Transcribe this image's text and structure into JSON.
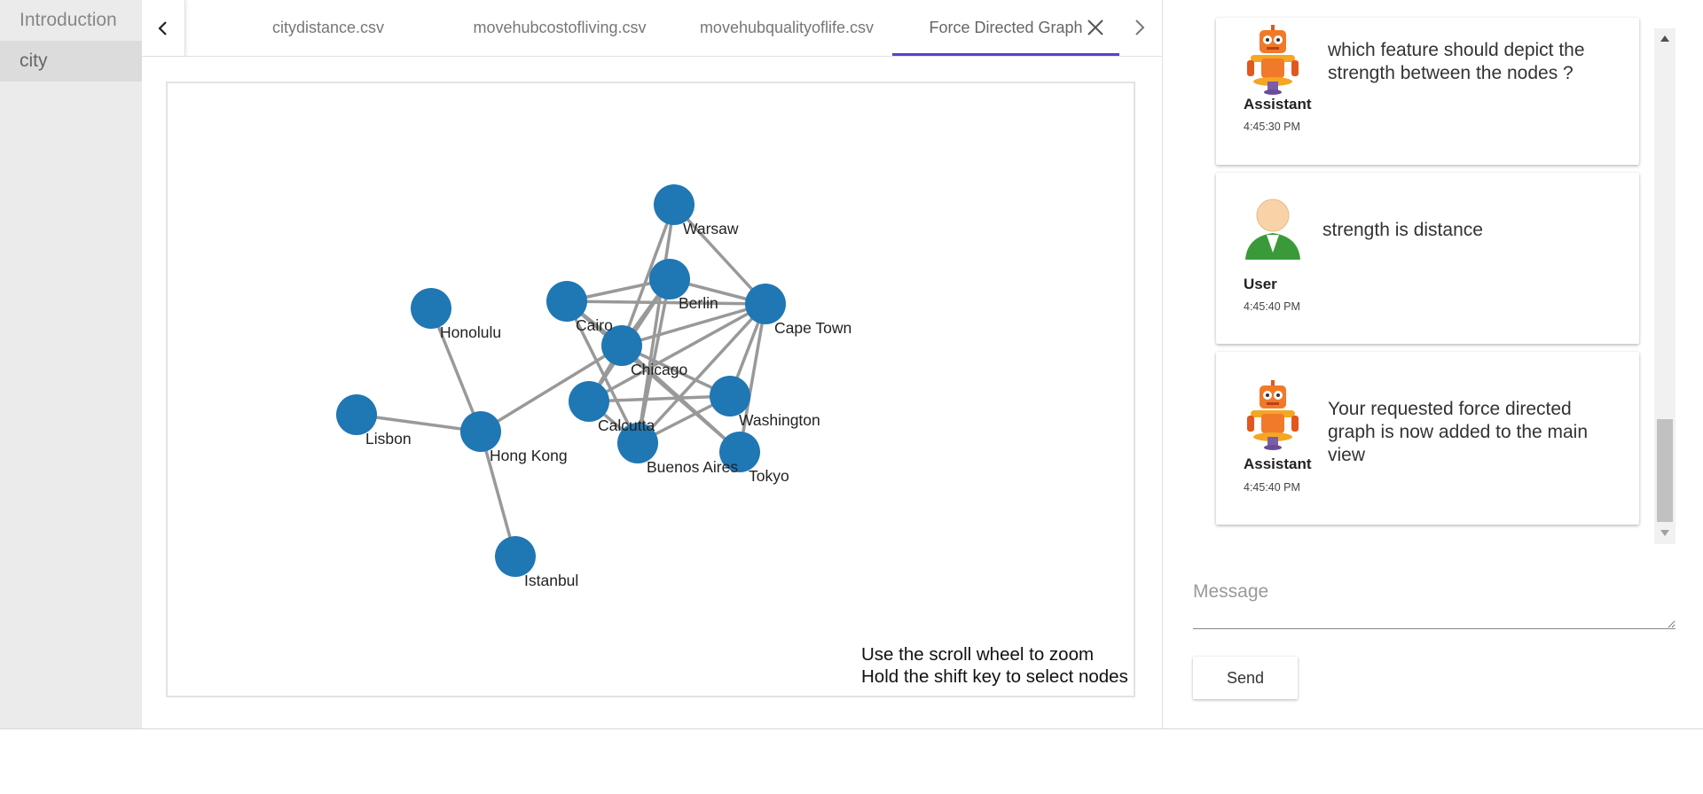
{
  "sidebar": {
    "items": [
      {
        "label": "Introduction"
      },
      {
        "label": "city"
      }
    ]
  },
  "tabs": {
    "items": [
      {
        "label": "citydistance.csv"
      },
      {
        "label": "movehubcostofliving.csv"
      },
      {
        "label": "movehubqualityoflife.csv"
      },
      {
        "label": "Force Directed Graph"
      }
    ],
    "active_color": "#5b3fd1"
  },
  "graph": {
    "node_color": "#1f77b4",
    "link_color": "#999999",
    "hint": [
      "Use the scroll wheel to zoom",
      "Hold the shift key to select nodes"
    ],
    "nodes": [
      {
        "id": "Warsaw"
      },
      {
        "id": "Berlin"
      },
      {
        "id": "Cairo"
      },
      {
        "id": "Cape Town"
      },
      {
        "id": "Honolulu"
      },
      {
        "id": "Chicago"
      },
      {
        "id": "Washington"
      },
      {
        "id": "Calcutta"
      },
      {
        "id": "Lisbon"
      },
      {
        "id": "Hong Kong"
      },
      {
        "id": "Buenos Aires"
      },
      {
        "id": "Tokyo"
      },
      {
        "id": "Istanbul"
      }
    ],
    "links": [
      [
        "Honolulu",
        "Hong Kong"
      ],
      [
        "Lisbon",
        "Hong Kong"
      ],
      [
        "Istanbul",
        "Hong Kong"
      ],
      [
        "Hong Kong",
        "Chicago"
      ],
      [
        "Warsaw",
        "Cape Town"
      ],
      [
        "Warsaw",
        "Chicago"
      ],
      [
        "Warsaw",
        "Buenos Aires"
      ],
      [
        "Berlin",
        "Cairo"
      ],
      [
        "Berlin",
        "Cape Town"
      ],
      [
        "Berlin",
        "Calcutta"
      ],
      [
        "Berlin",
        "Buenos Aires"
      ],
      [
        "Berlin",
        "Chicago"
      ],
      [
        "Cairo",
        "Cape Town"
      ],
      [
        "Cairo",
        "Chicago"
      ],
      [
        "Cairo",
        "Buenos Aires"
      ],
      [
        "Cairo",
        "Tokyo"
      ],
      [
        "Cape Town",
        "Chicago"
      ],
      [
        "Cape Town",
        "Calcutta"
      ],
      [
        "Cape Town",
        "Washington"
      ],
      [
        "Cape Town",
        "Buenos Aires"
      ],
      [
        "Cape Town",
        "Tokyo"
      ],
      [
        "Chicago",
        "Washington"
      ],
      [
        "Chicago",
        "Tokyo"
      ],
      [
        "Chicago",
        "Calcutta"
      ],
      [
        "Calcutta",
        "Washington"
      ],
      [
        "Buenos Aires",
        "Washington"
      ],
      [
        "Buenos Aires",
        "Calcutta"
      ]
    ]
  },
  "chat": {
    "messages": [
      {
        "role": "Assistant",
        "text": "which feature should depict the strength between the nodes ?",
        "time": "4:45:30 PM",
        "avatar": "robot-icon"
      },
      {
        "role": "User",
        "text": "strength is distance",
        "time": "4:45:40 PM",
        "avatar": "user-icon"
      },
      {
        "role": "Assistant",
        "text": "Your requested force directed graph is now added to the main view",
        "time": "4:45:40 PM",
        "avatar": "robot-icon"
      }
    ],
    "input_placeholder": "Message",
    "send_label": "Send"
  }
}
